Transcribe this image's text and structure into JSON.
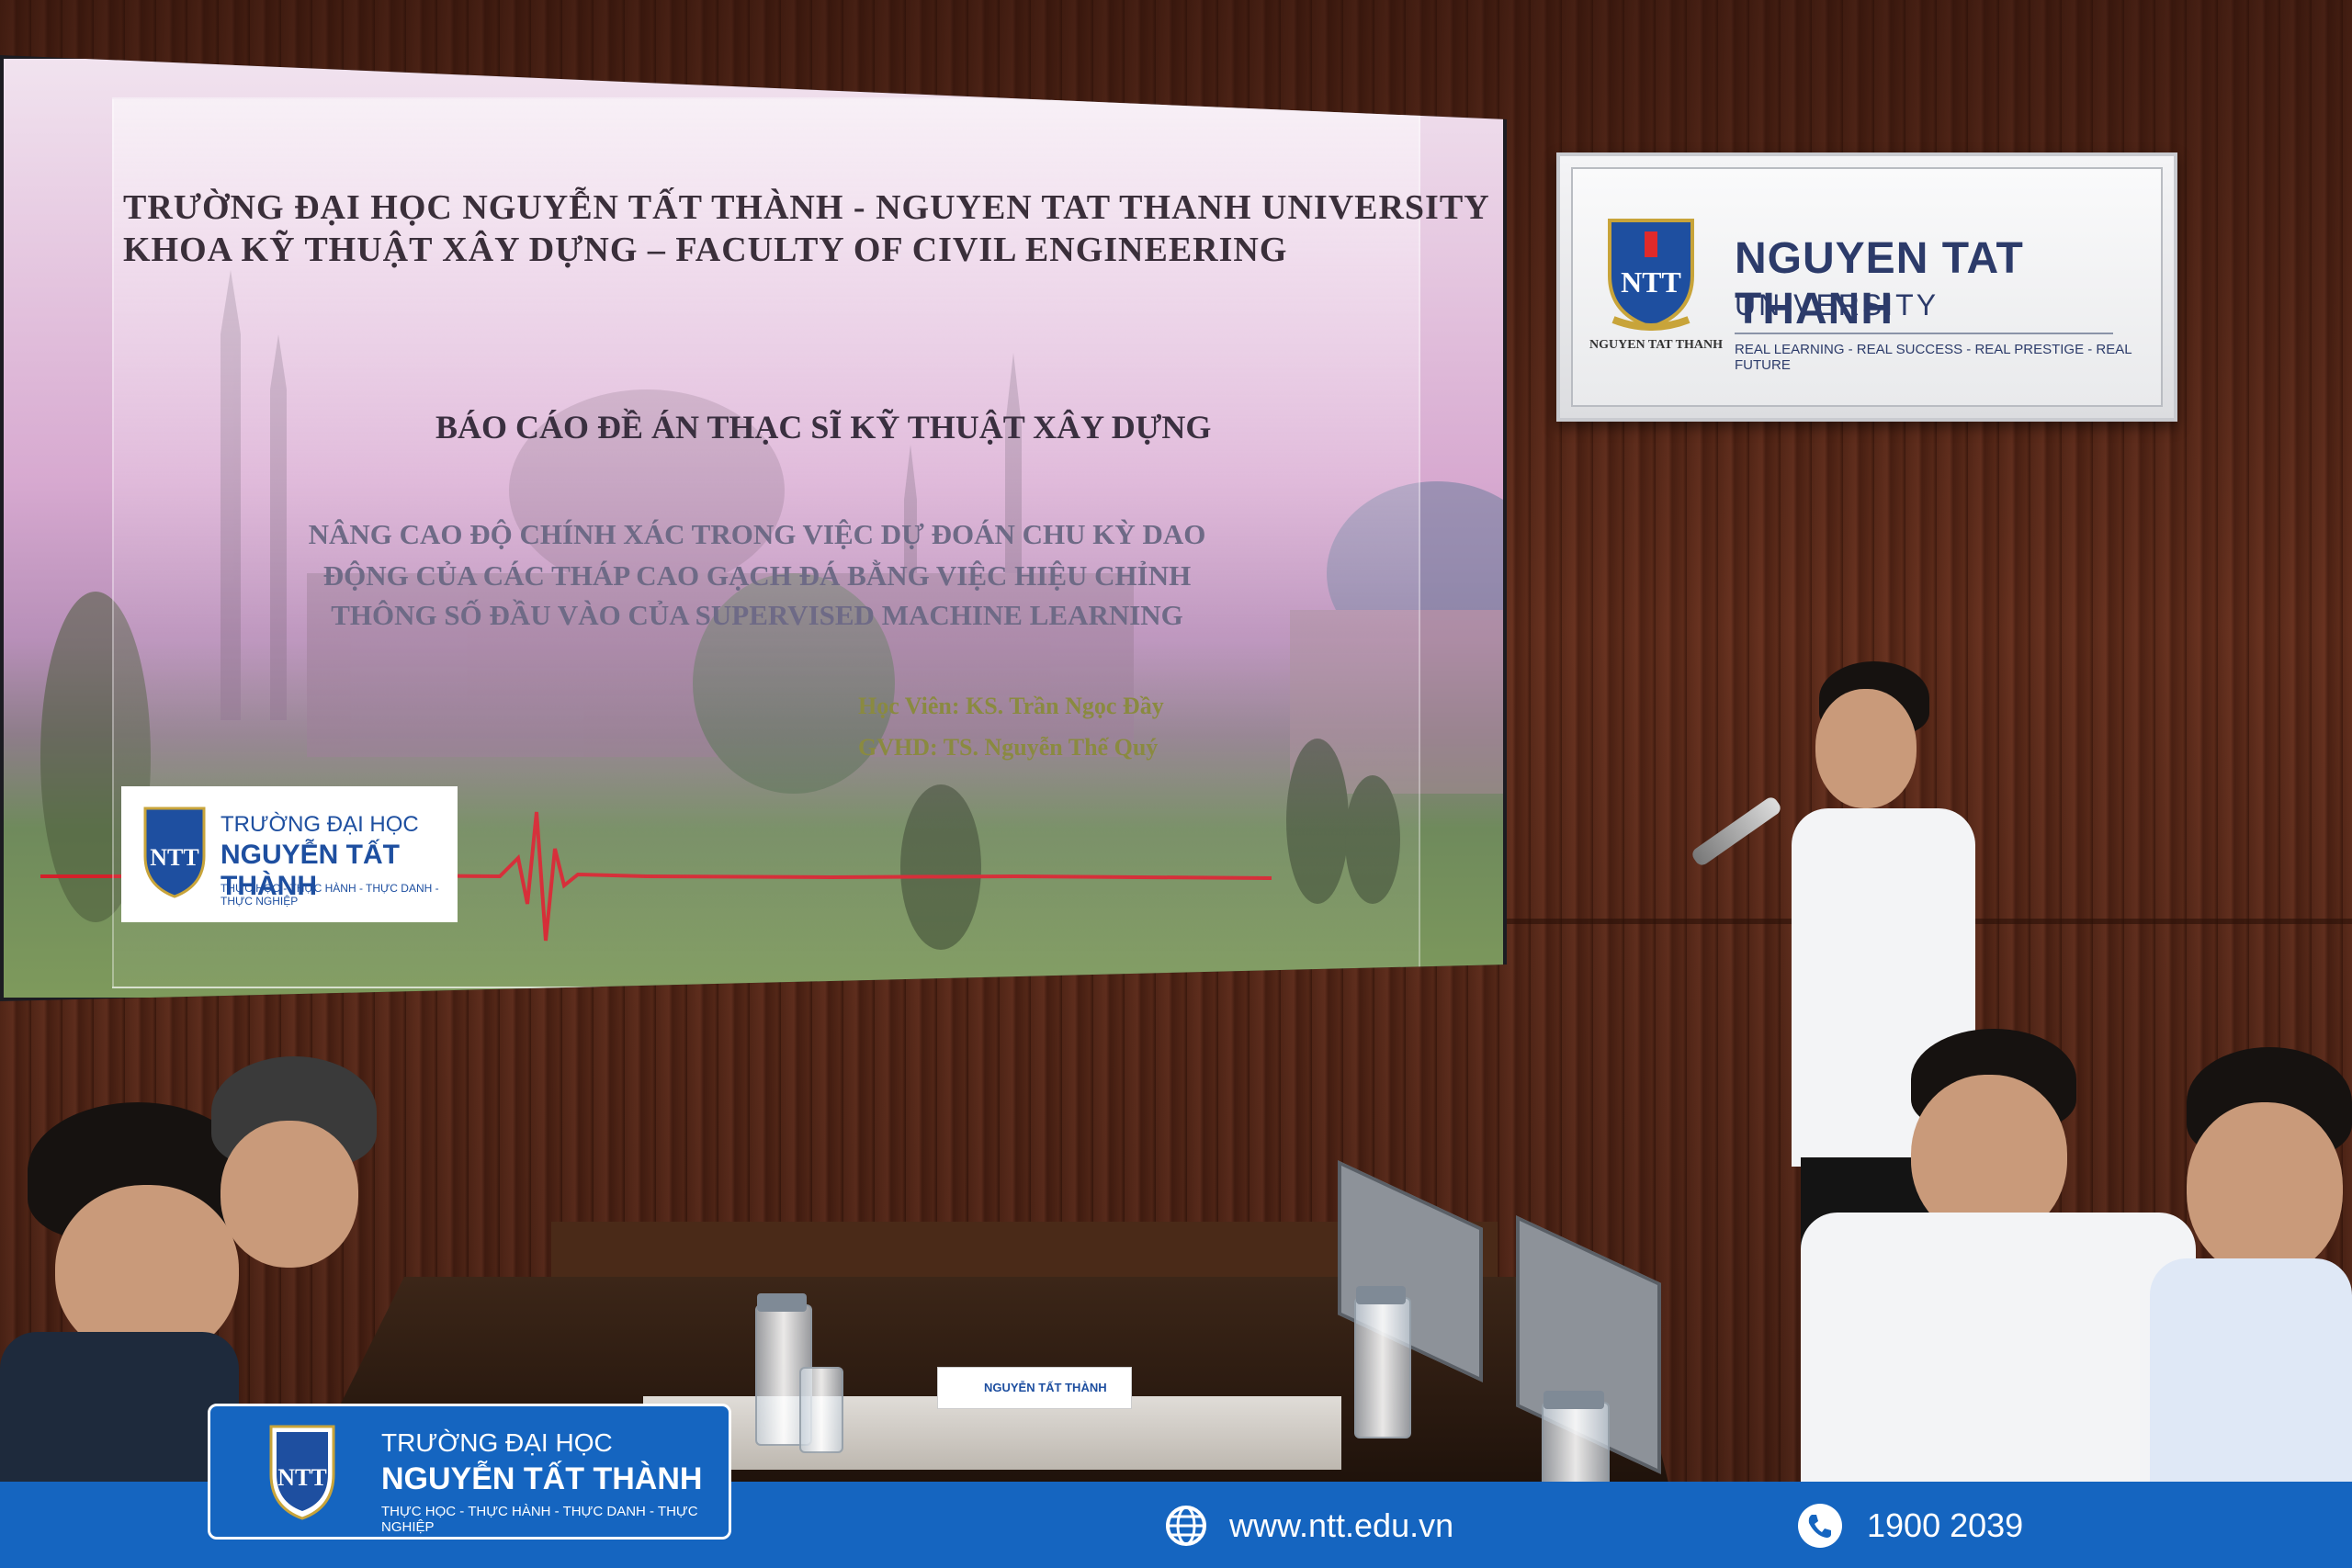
{
  "slide": {
    "university_line": "TRƯỜNG ĐẠI HỌC NGUYỄN TẤT THÀNH - NGUYEN TAT THANH UNIVERSITY",
    "faculty_line": "KHOA KỸ THUẬT XÂY DỰNG – FACULTY OF CIVIL ENGINEERING",
    "report_title": "BÁO CÁO ĐỀ ÁN THẠC SĨ KỸ THUẬT XÂY DỰNG",
    "topic_lines": [
      "NÂNG CAO ĐỘ CHÍNH XÁC TRONG VIỆC DỰ ĐOÁN CHU KỲ DAO",
      "ĐỘNG CỦA CÁC THÁP CAO GẠCH ĐÁ BẰNG VIỆC HIỆU CHỈNH",
      "THÔNG SỐ ĐẦU VÀO CỦA SUPERVISED MACHINE LEARNING"
    ],
    "student": "Học Viên: KS. Trần Ngọc Đầy",
    "advisor": "GVHD: TS. Nguyễn Thế Quý",
    "logo": {
      "line1": "TRƯỜNG ĐẠI HỌC",
      "line2": "NGUYỄN TẤT THÀNH",
      "line3": "THỰC HỌC - THỰC HÀNH - THỰC DANH - THỰC NGHIỆP"
    }
  },
  "plaque": {
    "name": "NGUYEN TAT THANH",
    "sub": "UNIVERSITY",
    "tagline": "REAL LEARNING - REAL SUCCESS - REAL PRESTIGE - REAL FUTURE",
    "crest_label": "NGUYEN TAT THANH"
  },
  "nameplate_text": "NGUYỄN TẤT THÀNH",
  "footer": {
    "logo_line1": "TRƯỜNG ĐẠI HỌC",
    "logo_line2": "NGUYỄN TẤT THÀNH",
    "logo_line3": "THỰC HỌC - THỰC HÀNH - THỰC DANH - THỰC NGHIỆP",
    "website": "www.ntt.edu.vn",
    "phone": "1900 2039",
    "icons": [
      "globe-icon",
      "phone-icon"
    ]
  },
  "colors": {
    "footer_blue": "#1565c0",
    "brand_navy": "#2c3b6a",
    "wall_wood": "#5a2a1a"
  }
}
